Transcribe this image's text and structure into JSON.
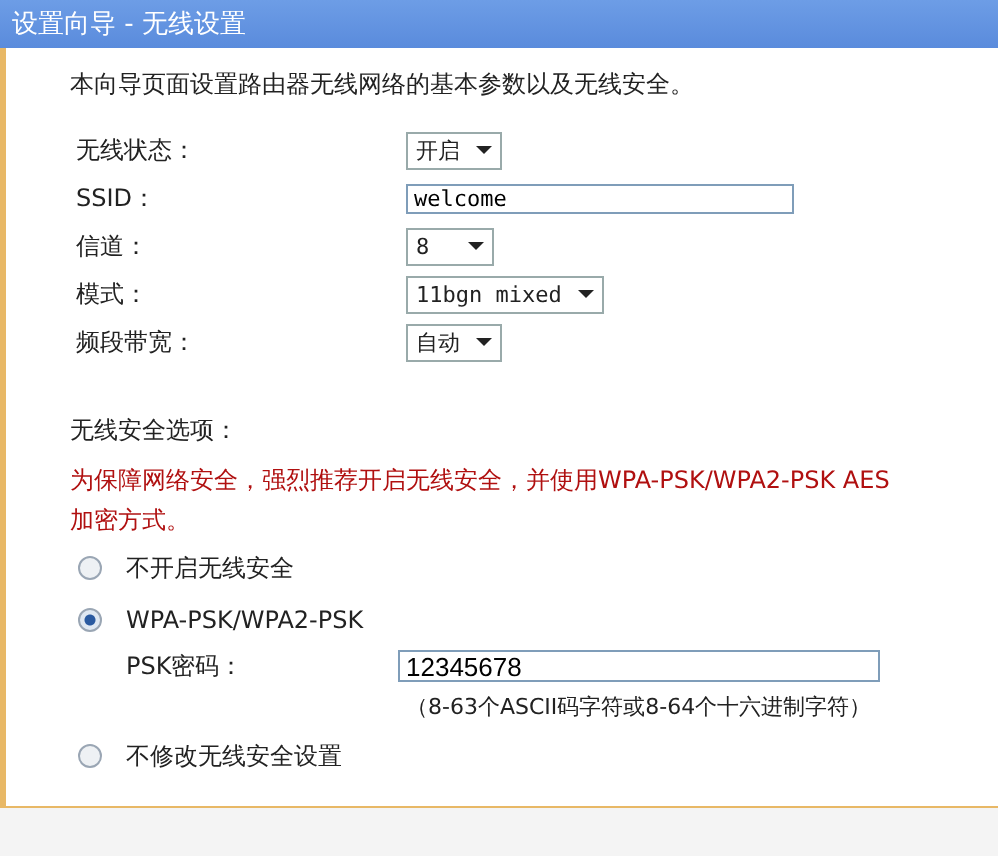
{
  "window": {
    "title": "设置向导 - 无线设置"
  },
  "intro": "本向导页面设置路由器无线网络的基本参数以及无线安全。",
  "fields": [
    {
      "kind": "select",
      "label": "无线状态：",
      "value": "开启"
    },
    {
      "kind": "text",
      "label": "SSID：",
      "value": "welcome"
    },
    {
      "kind": "select",
      "label": "信道：",
      "value": "8"
    },
    {
      "kind": "select",
      "label": "模式：",
      "value": "11bgn mixed"
    },
    {
      "kind": "select",
      "label": "频段带宽：",
      "value": "自动"
    }
  ],
  "security": {
    "heading": "无线安全选项：",
    "warning": "为保障网络安全，强烈推荐开启无线安全，并使用WPA-PSK/WPA2-PSK AES加密方式。",
    "options": [
      {
        "label": "不开启无线安全",
        "selected": false
      },
      {
        "label": "WPA-PSK/WPA2-PSK",
        "selected": true,
        "password": {
          "label": "PSK密码：",
          "value": "12345678",
          "hint": "（8-63个ASCII码字符或8-64个十六进制字符）"
        }
      },
      {
        "label": "不修改无线安全设置",
        "selected": false
      }
    ]
  }
}
